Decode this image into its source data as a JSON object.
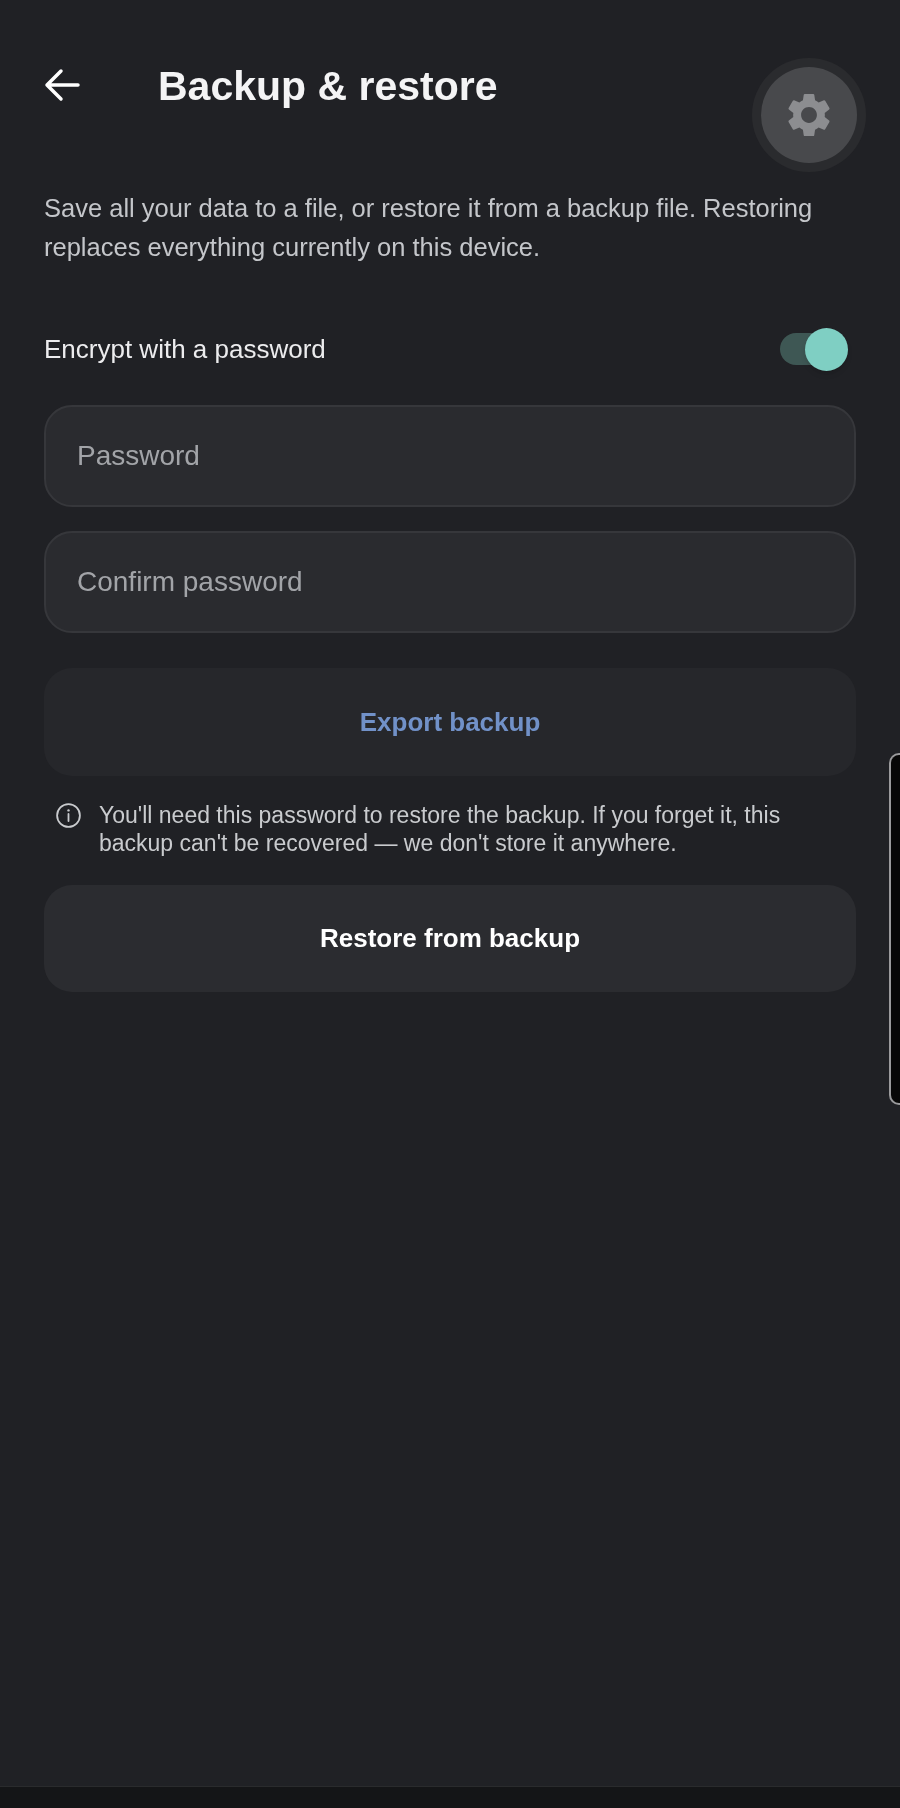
{
  "header": {
    "title": "Backup & restore"
  },
  "description": "Save all your data to a file, or restore it from a backup file. Restoring replaces everything currently on this device.",
  "encrypt": {
    "label": "Encrypt with a password",
    "on": true
  },
  "fields": [
    {
      "placeholder": "Password"
    },
    {
      "placeholder": "Confirm password"
    }
  ],
  "export_button": {
    "label": "Export backup"
  },
  "notice": {
    "text": "You'll need this password to restore the backup. If you forget it, this backup can't be recovered — we don't store it anywhere."
  },
  "restore_button": {
    "label": "Restore from backup"
  }
}
